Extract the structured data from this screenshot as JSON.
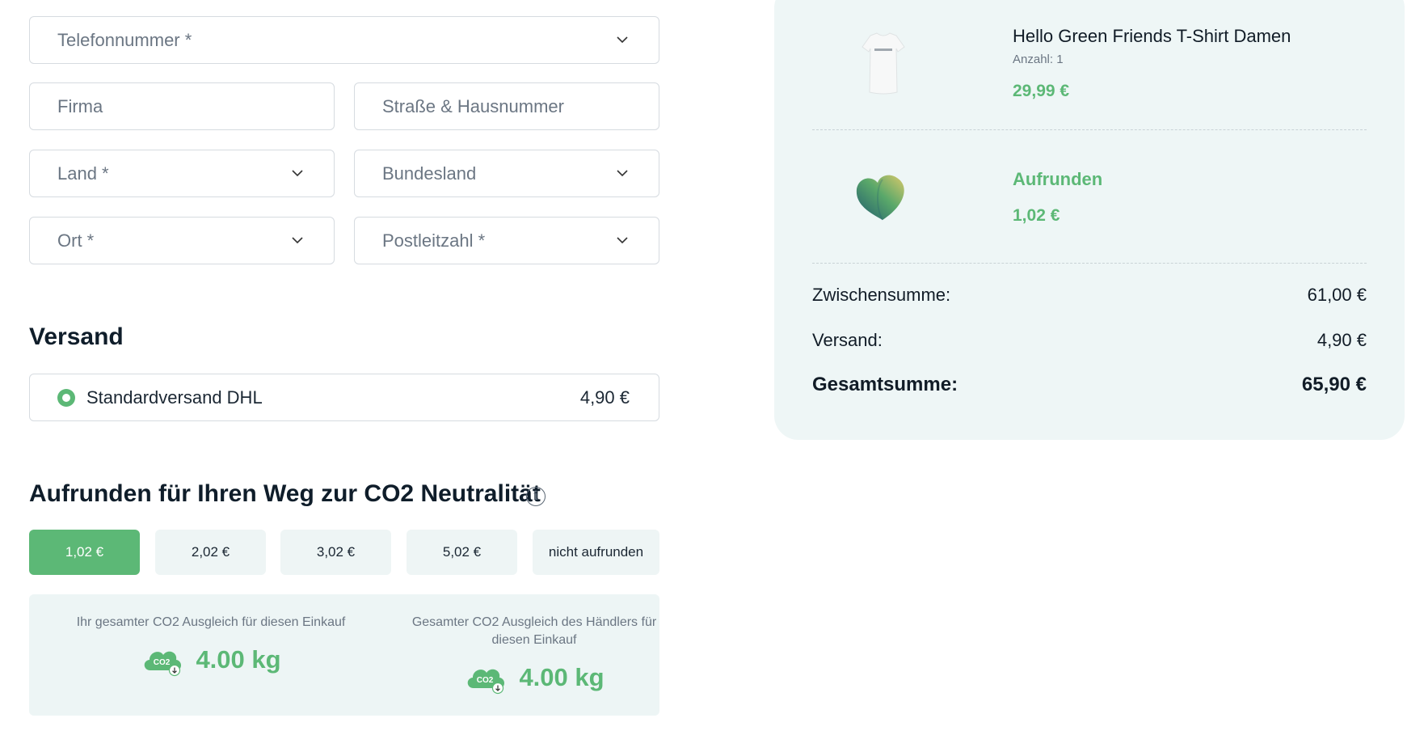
{
  "address_form": {
    "phone_placeholder": "Telefonnummer *",
    "company_placeholder": "Firma",
    "street_placeholder": "Straße & Hausnummer",
    "country_placeholder": "Land *",
    "state_placeholder": "Bundesland",
    "city_placeholder": "Ort *",
    "zip_placeholder": "Postleitzahl *"
  },
  "shipping": {
    "heading": "Versand",
    "option_name": "Standardversand DHL",
    "option_price": "4,90 €"
  },
  "roundup": {
    "heading": "Aufrunden für Ihren Weg zur CO2 Neutralität",
    "options": [
      "1,02 €",
      "2,02 €",
      "3,02 €",
      "5,02 €",
      "nicht aufrunden"
    ],
    "selected_index": 0,
    "customer_label": "Ihr gesamter CO2 Ausgleich für diesen Einkauf",
    "customer_value": "4.00 kg",
    "merchant_label": "Gesamter CO2 Ausgleich des Händlers für diesen Einkauf",
    "merchant_value": "4.00 kg",
    "cloud_text": "CO2"
  },
  "cart": {
    "item_name": "Hello Green Friends T-Shirt Damen",
    "item_qty": "Anzahl: 1",
    "item_price": "29,99 €",
    "roundup_label": "Aufrunden",
    "roundup_price": "1,02 €"
  },
  "totals": {
    "subtotal_label": "Zwischensumme:",
    "subtotal_value": "61,00 €",
    "shipping_label": "Versand:",
    "shipping_value": "4,90 €",
    "total_label": "Gesamtsumme:",
    "total_value": "65,90 €"
  },
  "colors": {
    "accent": "#5cb876",
    "panel_bg": "#eef6f6"
  }
}
